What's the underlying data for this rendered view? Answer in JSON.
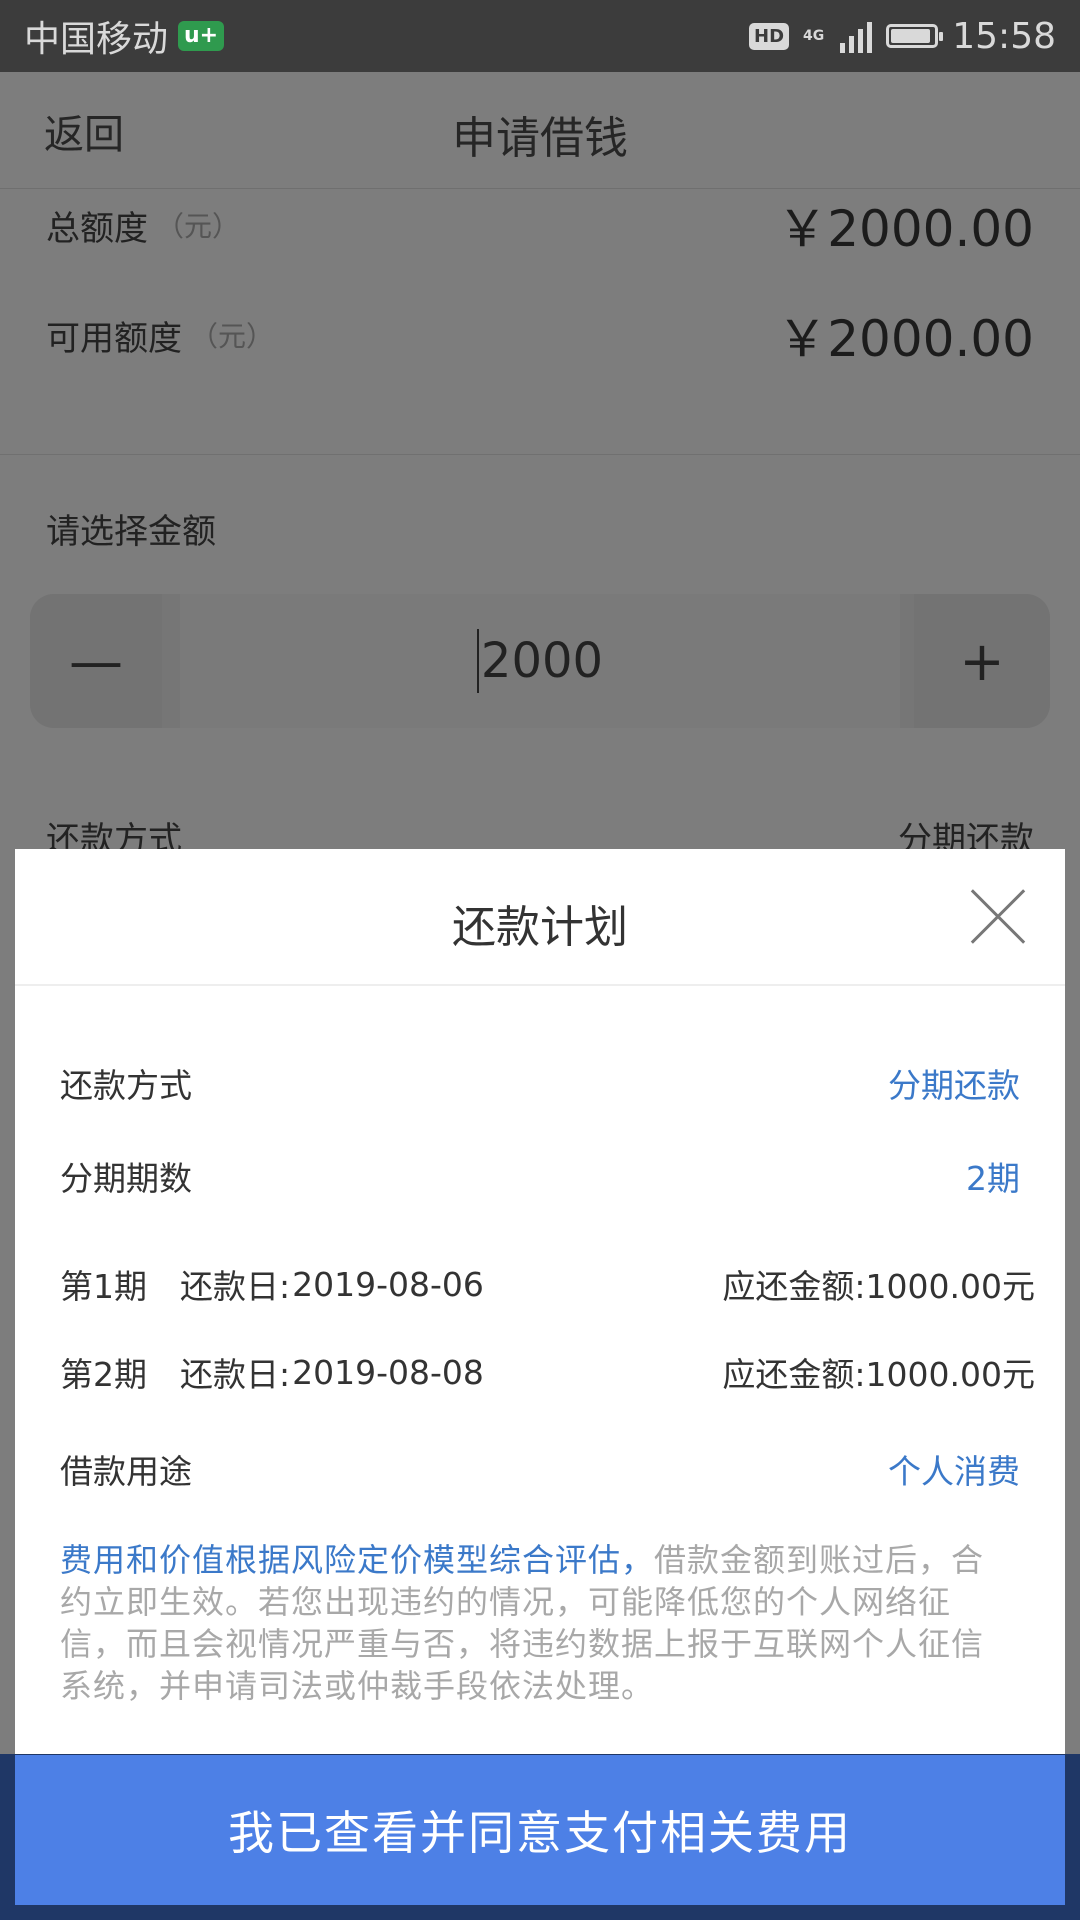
{
  "status_bar": {
    "carrier": "中国移动",
    "carrier_badge": "u+",
    "hd_badge": "HD",
    "network": "4G",
    "time": "15:58"
  },
  "nav": {
    "back": "返回",
    "title": "申请借钱"
  },
  "limits": {
    "total_label": "总额度",
    "total_unit": "（元）",
    "total_value": "￥2000.00",
    "available_label": "可用额度",
    "available_unit": "（元）",
    "available_value": "￥2000.00"
  },
  "amount": {
    "label": "请选择金额",
    "minus": "—",
    "value": "2000",
    "plus": "+"
  },
  "background_repay": {
    "label": "还款方式",
    "value": "分期还款"
  },
  "modal": {
    "title": "还款计划",
    "method_label": "还款方式",
    "method_value": "分期还款",
    "installments_label": "分期期数",
    "installments_value": "2期",
    "periods": [
      {
        "period": "第1期",
        "date_label": "还款日:",
        "date": "2019-08-06",
        "amount_label": "应还金额:",
        "amount": "1000.00元"
      },
      {
        "period": "第2期",
        "date_label": "还款日:",
        "date": "2019-08-08",
        "amount_label": "应还金额:",
        "amount": "1000.00元"
      }
    ],
    "purpose_label": "借款用途",
    "purpose_value": "个人消费",
    "notice_highlight": "费用和价值根据风险定价模型综合评估，",
    "notice_text": "借款金额到账过后，合约立即生效。若您出现违约的情况，可能降低您的个人网络征信，而且会视情况严重与否，将违约数据上报于互联网个人征信系统，并申请司法或仲裁手段依法处理。",
    "agree_button": "我已查看并同意支付相关费用"
  },
  "colors": {
    "accent_blue": "#3b79c9",
    "button_blue": "#4d80e6",
    "status_bar": "#3c3c3c",
    "overlay_gray": "#7d7d7d"
  }
}
